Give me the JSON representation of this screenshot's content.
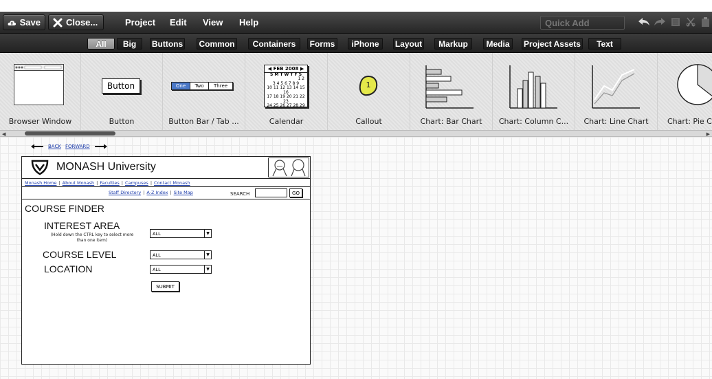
{
  "toolbar": {
    "save_label": "Save",
    "close_label": "Close...",
    "menus": [
      "Project",
      "Edit",
      "View",
      "Help"
    ],
    "quick_add_placeholder": "Quick Add"
  },
  "filters": [
    "All",
    "Big",
    "Buttons",
    "Common",
    "Containers",
    "Forms",
    "iPhone",
    "Layout",
    "Markup",
    "Media",
    "Project Assets",
    "Text"
  ],
  "library": {
    "items": [
      "Browser Window",
      "Button",
      "Button Bar / Tab ...",
      "Calendar",
      "Callout",
      "Chart: Bar Chart",
      "Chart: Column C...",
      "Chart: Line Chart",
      "Chart: Pie C"
    ],
    "button_sample": "Button",
    "tabbar_sample": [
      "One",
      "Two",
      "Three"
    ],
    "calendar_sample": {
      "header": "FEB 2008",
      "days": "S M T W T F S",
      "rows": [
        "3 4 5 6 7 8 9",
        "10 11 12 13 14 15 16",
        "17 18 19 20 21 22 23",
        "24 25 26 27 28 29"
      ],
      "first": "1 2"
    },
    "callout_sample": "1"
  },
  "mockup": {
    "nav": {
      "back": "BACK",
      "forward": "FORWARD"
    },
    "site_title": "MONASH University",
    "links_row1": [
      "Monash Home",
      "About Monash",
      "Faculties",
      "Campuses",
      "Contact Monash"
    ],
    "links_row2": [
      "Staff Directory",
      "A-Z Index",
      "Site Map"
    ],
    "search_label": "SEARCH",
    "go_label": "GO",
    "finder_title": "COURSE FINDER",
    "interest_label": "INTEREST AREA",
    "interest_hint": "(Hold down the CTRL key to select more than one item)",
    "level_label": "COURSE LEVEL",
    "location_label": "LOCATION",
    "select_value": "ALL",
    "submit_label": "SUBMIT"
  },
  "colors": {
    "toolbar_bg": "#333333",
    "accent_link": "#1a3aaa",
    "callout_fill": "#e4e84a"
  }
}
